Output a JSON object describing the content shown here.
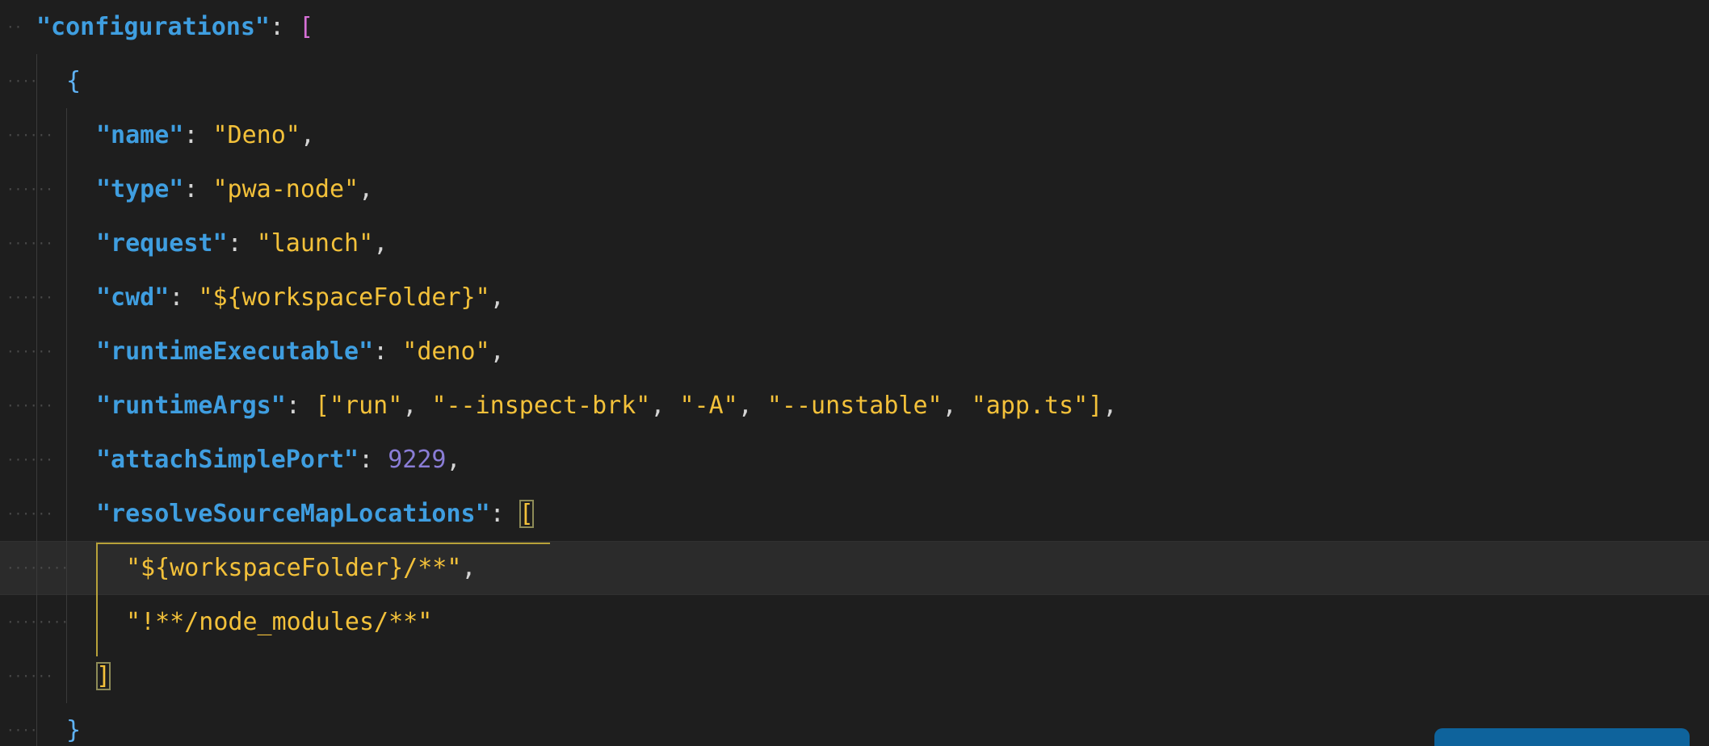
{
  "editor": {
    "lines": [
      {
        "indent": 1,
        "tokens": [
          {
            "t": "\"configurations\"",
            "c": "key"
          },
          {
            "t": ": ",
            "c": "punc"
          },
          {
            "t": "[",
            "c": "bracket-pink"
          }
        ]
      },
      {
        "indent": 2,
        "tokens": [
          {
            "t": "{",
            "c": "bracket-blue"
          }
        ]
      },
      {
        "indent": 3,
        "tokens": [
          {
            "t": "\"name\"",
            "c": "key"
          },
          {
            "t": ": ",
            "c": "punc"
          },
          {
            "t": "\"Deno\"",
            "c": "str"
          },
          {
            "t": ",",
            "c": "punc"
          }
        ]
      },
      {
        "indent": 3,
        "tokens": [
          {
            "t": "\"type\"",
            "c": "key"
          },
          {
            "t": ": ",
            "c": "punc"
          },
          {
            "t": "\"pwa-node\"",
            "c": "str"
          },
          {
            "t": ",",
            "c": "punc"
          }
        ]
      },
      {
        "indent": 3,
        "tokens": [
          {
            "t": "\"request\"",
            "c": "key"
          },
          {
            "t": ": ",
            "c": "punc"
          },
          {
            "t": "\"launch\"",
            "c": "str"
          },
          {
            "t": ",",
            "c": "punc"
          }
        ]
      },
      {
        "indent": 3,
        "tokens": [
          {
            "t": "\"cwd\"",
            "c": "key"
          },
          {
            "t": ": ",
            "c": "punc"
          },
          {
            "t": "\"${workspaceFolder}\"",
            "c": "str"
          },
          {
            "t": ",",
            "c": "punc"
          }
        ]
      },
      {
        "indent": 3,
        "tokens": [
          {
            "t": "\"runtimeExecutable\"",
            "c": "key"
          },
          {
            "t": ": ",
            "c": "punc"
          },
          {
            "t": "\"deno\"",
            "c": "str"
          },
          {
            "t": ",",
            "c": "punc"
          }
        ]
      },
      {
        "indent": 3,
        "tokens": [
          {
            "t": "\"runtimeArgs\"",
            "c": "key"
          },
          {
            "t": ": ",
            "c": "punc"
          },
          {
            "t": "[",
            "c": "bracket-yellow"
          },
          {
            "t": "\"run\"",
            "c": "str"
          },
          {
            "t": ", ",
            "c": "punc"
          },
          {
            "t": "\"--inspect-brk\"",
            "c": "str"
          },
          {
            "t": ", ",
            "c": "punc"
          },
          {
            "t": "\"-A\"",
            "c": "str"
          },
          {
            "t": ", ",
            "c": "punc"
          },
          {
            "t": "\"--unstable\"",
            "c": "str"
          },
          {
            "t": ", ",
            "c": "punc"
          },
          {
            "t": "\"app.ts\"",
            "c": "str"
          },
          {
            "t": "]",
            "c": "bracket-yellow"
          },
          {
            "t": ",",
            "c": "punc"
          }
        ]
      },
      {
        "indent": 3,
        "tokens": [
          {
            "t": "\"attachSimplePort\"",
            "c": "key"
          },
          {
            "t": ": ",
            "c": "punc"
          },
          {
            "t": "9229",
            "c": "num"
          },
          {
            "t": ",",
            "c": "punc"
          }
        ]
      },
      {
        "indent": 3,
        "tokens": [
          {
            "t": "\"resolveSourceMapLocations\"",
            "c": "key"
          },
          {
            "t": ": ",
            "c": "punc"
          },
          {
            "t": "[",
            "c": "bracket-yellow bmatch"
          }
        ]
      },
      {
        "indent": 4,
        "active": true,
        "tokens": [
          {
            "t": "\"${workspaceFolder}/**\"",
            "c": "str"
          },
          {
            "t": ",",
            "c": "punc"
          }
        ]
      },
      {
        "indent": 4,
        "tokens": [
          {
            "t": "\"!**/node_modules/**\"",
            "c": "str"
          }
        ]
      },
      {
        "indent": 3,
        "tokens": [
          {
            "t": "]",
            "c": "bracket-yellow bmatch"
          }
        ]
      },
      {
        "indent": 2,
        "tokens": [
          {
            "t": "}",
            "c": "bracket-blue"
          }
        ]
      }
    ]
  },
  "colors": {
    "background": "#1e1e1e",
    "key": "#3f9ee0",
    "string": "#f3c13a",
    "number": "#8a7dd6",
    "bracket_pink": "#d670d6",
    "bracket_blue": "#5fb3f6",
    "accent_button": "#0e639c"
  }
}
